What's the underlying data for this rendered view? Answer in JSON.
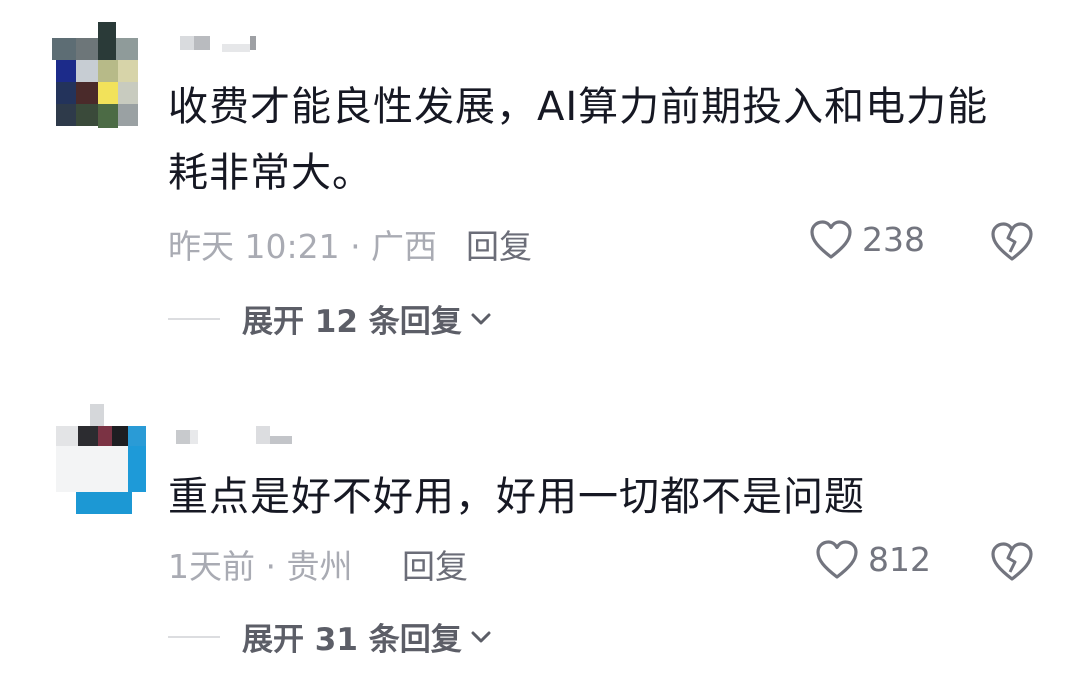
{
  "comments": [
    {
      "text": "收费才能良性发展，AI算力前期投入和电力能耗非常大。",
      "meta": "昨天 10:21 · 广西",
      "reply_label": "回复",
      "likes": "238",
      "expand_label": "展开 12 条回复"
    },
    {
      "text": "重点是好不好用，好用一切都不是问题",
      "meta": "1天前 · 贵州",
      "reply_label": "回复",
      "likes": "812",
      "expand_label": "展开 31 条回复"
    }
  ],
  "icons": {
    "like": "heart-outline-icon",
    "dislike": "broken-heart-icon",
    "expand": "chevron-down-icon"
  },
  "colors": {
    "text": "#161823",
    "meta": "#a9abb3",
    "reply": "#6b6d78",
    "icon": "#73757f"
  }
}
